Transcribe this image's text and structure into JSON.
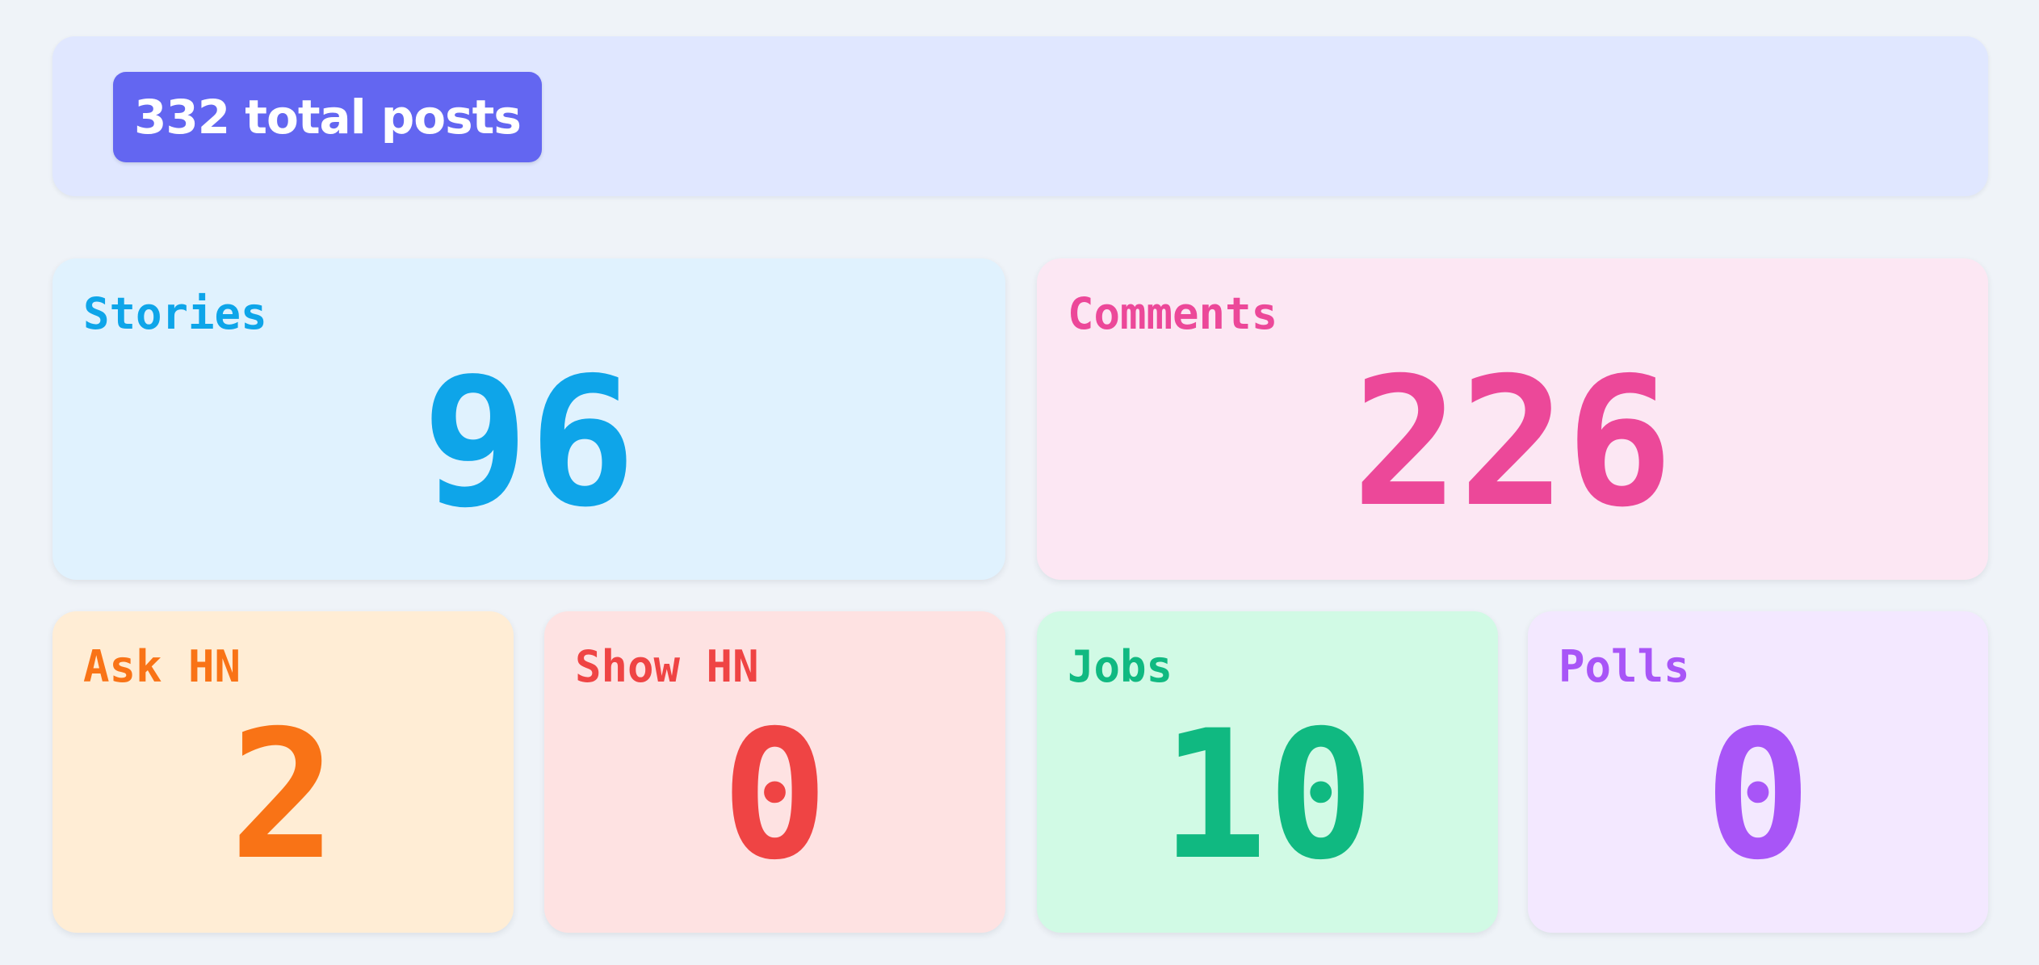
{
  "summary": {
    "total_label": "332 total posts"
  },
  "cards": {
    "stories": {
      "label": "Stories",
      "value": "96",
      "color": "#0ea5e9",
      "background": "#e0f2fe"
    },
    "comments": {
      "label": "Comments",
      "value": "226",
      "color": "#ec4899",
      "background": "#fce7f3"
    },
    "ask_hn": {
      "label": "Ask HN",
      "value": "2",
      "color": "#f97316",
      "background": "#ffedd5"
    },
    "show_hn": {
      "label": "Show HN",
      "value": "0",
      "color": "#ef4444",
      "background": "#fee2e2"
    },
    "jobs": {
      "label": "Jobs",
      "value": "10",
      "color": "#10b981",
      "background": "#d1fae5"
    },
    "polls": {
      "label": "Polls",
      "value": "0",
      "color": "#a855f7",
      "background": "#f3e8ff"
    }
  },
  "colors": {
    "page_background": "#eff3f8",
    "summary_background": "#e0e7ff",
    "badge_background": "#6366f1",
    "badge_text": "#ffffff"
  }
}
